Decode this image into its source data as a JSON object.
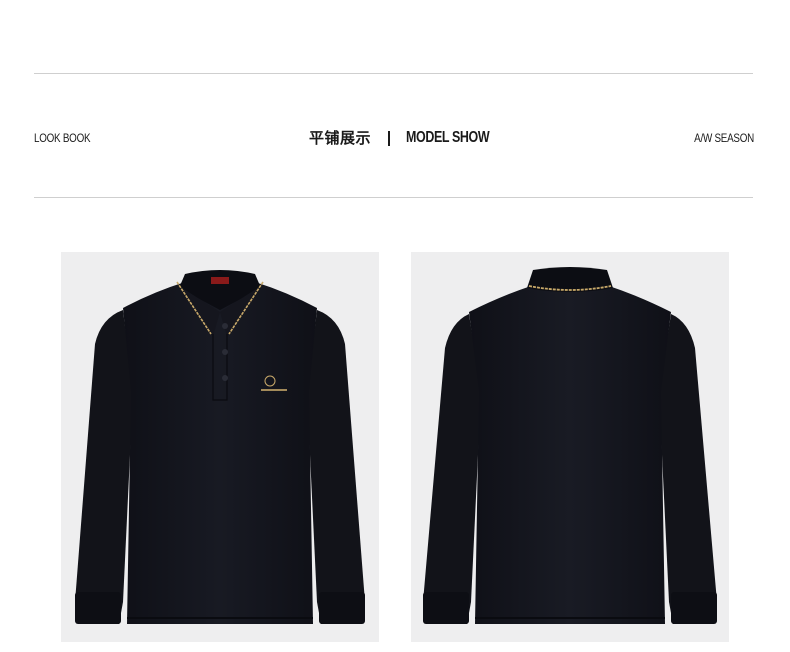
{
  "header": {
    "left_label": "LOOK BOOK",
    "title_cn": "平铺展示",
    "title_en": "MODEL SHOW",
    "right_label": "A/W SEASON"
  },
  "colors": {
    "shirt": "#14151d",
    "panel_bg": "#eeeeef",
    "collar_accent": "#c8a96a",
    "label_red": "#8a1a1a",
    "rule": "#cfcfcf"
  },
  "images": [
    {
      "name": "front-view",
      "subject": "black long-sleeve polo shirt, front"
    },
    {
      "name": "back-view",
      "subject": "black long-sleeve polo shirt, back"
    }
  ]
}
